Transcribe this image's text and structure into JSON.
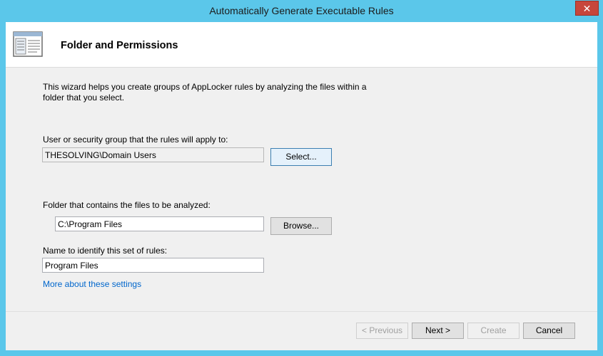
{
  "window": {
    "title": "Automatically Generate Executable Rules",
    "close_glyph": "✕"
  },
  "header": {
    "title": "Folder and Permissions",
    "icon": "wizard-window-icon"
  },
  "intro_text": "This wizard helps you create groups of AppLocker rules by analyzing the files within a folder that you select.",
  "user_group": {
    "label": "User or security group that the rules will apply to:",
    "value": "THESOLVING\\Domain Users",
    "button_label": "Select..."
  },
  "folder": {
    "label": "Folder that contains the files to be analyzed:",
    "value": "C:\\Program Files",
    "button_label": "Browse..."
  },
  "rule_name": {
    "label": "Name to identify this set of rules:",
    "value": "Program Files"
  },
  "more_link": "More about these settings",
  "footer": {
    "previous_label": "< Previous",
    "next_label": "Next >",
    "create_label": "Create",
    "cancel_label": "Cancel"
  },
  "colors": {
    "titlebar": "#5bc7ea",
    "close_button": "#c7463b",
    "link": "#0066cc",
    "client_bg": "#f0f0f0"
  }
}
